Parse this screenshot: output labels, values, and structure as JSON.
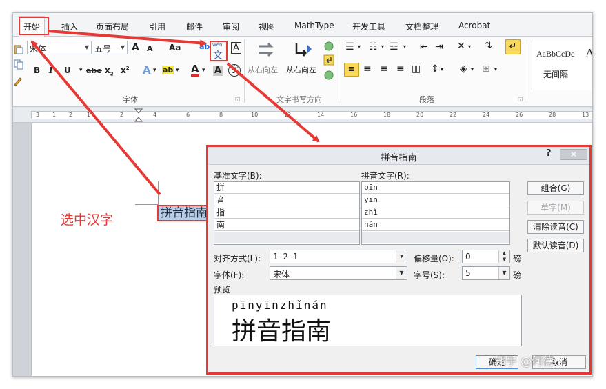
{
  "tabs": [
    {
      "label": "开始",
      "active": true
    },
    {
      "label": "插入"
    },
    {
      "label": "页面布局"
    },
    {
      "label": "引用"
    },
    {
      "label": "邮件"
    },
    {
      "label": "审阅"
    },
    {
      "label": "视图"
    },
    {
      "label": "MathType"
    },
    {
      "label": "开发工具"
    },
    {
      "label": "文档整理"
    },
    {
      "label": "Acrobat"
    }
  ],
  "ribbon": {
    "font_name": "宋体",
    "font_size": "五号",
    "grow_font": "A",
    "shrink_font": "A",
    "change_case": "Aa",
    "bold": "B",
    "italic": "I",
    "underline": "U",
    "strikethrough": "abe",
    "subscript": "x",
    "superscript": "x",
    "phonetic_guide_label": "文",
    "phonetic_guide_top": "wén",
    "char_border": "A",
    "char_shading": "A",
    "enclose_char": "字",
    "font_group_label": "字体",
    "rtl_label": "从右向左",
    "ltr_label": "从右向左",
    "text_direction_group_label": "文字书写方向",
    "paragraph_group_label": "段落",
    "style_sample": "AaBbCcDc",
    "style_name": "无间隔",
    "style_overflow": "A"
  },
  "ruler": {
    "ticks": [
      "3",
      "1",
      "2",
      "1",
      "2",
      "4",
      "6",
      "8",
      "10",
      "12",
      "14",
      "16",
      "18",
      "20",
      "22",
      "24",
      "26",
      "28",
      "13"
    ]
  },
  "document": {
    "selected_text": "拼音指南",
    "paragraph_mark": "↵",
    "annotation": "选中汉字"
  },
  "dialog": {
    "title": "拼音指南",
    "help": "?",
    "close": "✕",
    "base_text_header": "基准文字(B):",
    "ruby_text_header": "拼音文字(R):",
    "rows": [
      {
        "base": "拼",
        "ruby": "pīn"
      },
      {
        "base": "音",
        "ruby": "yīn"
      },
      {
        "base": "指",
        "ruby": "zhǐ"
      },
      {
        "base": "南",
        "ruby": "nán"
      },
      {
        "base": "",
        "ruby": ""
      }
    ],
    "buttons": {
      "group": "组合(G)",
      "mono": "单字(M)",
      "clear": "清除读音(C)",
      "default": "默认读音(D)"
    },
    "alignment_label": "对齐方式(L):",
    "alignment_value": "1-2-1",
    "offset_label": "偏移量(O):",
    "offset_value": "0",
    "offset_unit": "磅",
    "font_label": "字体(F):",
    "font_value": "宋体",
    "size_label": "字号(S):",
    "size_value": "5",
    "size_unit": "磅",
    "preview_label": "预览",
    "preview_pinyin": "pīnyīnzhǐnán",
    "preview_hanzi": "拼音指南",
    "ok": "确定",
    "cancel": "取消"
  },
  "watermark": "知乎 @何德",
  "colors": {
    "highlight_red": "#e53935",
    "selection_blue": "#b7cde8"
  }
}
